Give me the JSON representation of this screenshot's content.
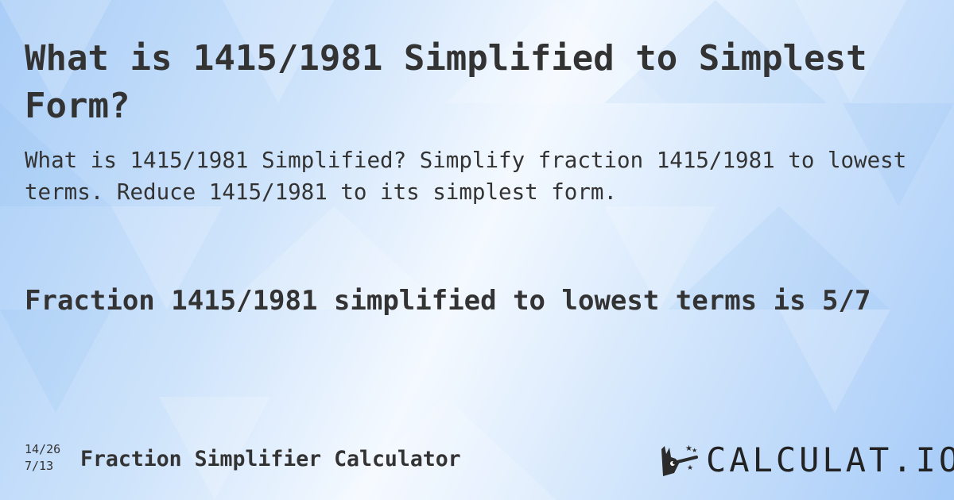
{
  "heading": "What is 1415/1981 Simplified to Simplest Form?",
  "description": "What is 1415/1981 Simplified? Simplify fraction 1415/1981 to lowest terms. Reduce 1415/1981 to its simplest form.",
  "answer": "Fraction 1415/1981 simplified to lowest terms is 5/7",
  "footer": {
    "example_top": "14/26",
    "example_bottom": "7/13",
    "calculator_name": "Fraction Simplifier Calculator",
    "logo_icon": "magic-wand-hand-icon",
    "logo_text": "CALCULAT.IO"
  },
  "colors": {
    "text": "#333333",
    "background_light": "#f4f9ff",
    "background_blue": "#a6cbf8"
  }
}
